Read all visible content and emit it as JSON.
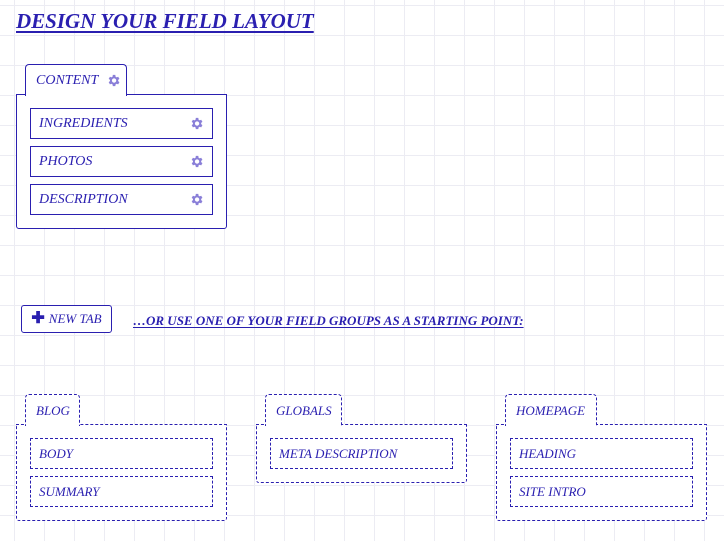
{
  "page_title": "DESIGN YOUR FIELD LAYOUT",
  "active_tab": {
    "label": "CONTENT",
    "fields": [
      {
        "label": "INGREDIENTS"
      },
      {
        "label": "PHOTOS"
      },
      {
        "label": "DESCRIPTION"
      }
    ]
  },
  "new_tab_label": "NEW TAB",
  "starting_point_text": "…OR USE ONE OF YOUR FIELD GROUPS AS A STARTING POINT:",
  "field_groups": [
    {
      "label": "BLOG",
      "fields": [
        "BODY",
        "SUMMARY"
      ]
    },
    {
      "label": "GLOBALS",
      "fields": [
        "META DESCRIPTION"
      ]
    },
    {
      "label": "HOMEPAGE",
      "fields": [
        "HEADING",
        "SITE INTRO"
      ]
    }
  ],
  "colors": {
    "accent": "#2a1fb0",
    "icon": "#8a7fd8"
  },
  "icons": {
    "tab_settings": "gear-icon",
    "field_settings": "gear-icon",
    "new_tab": "plus-icon"
  }
}
